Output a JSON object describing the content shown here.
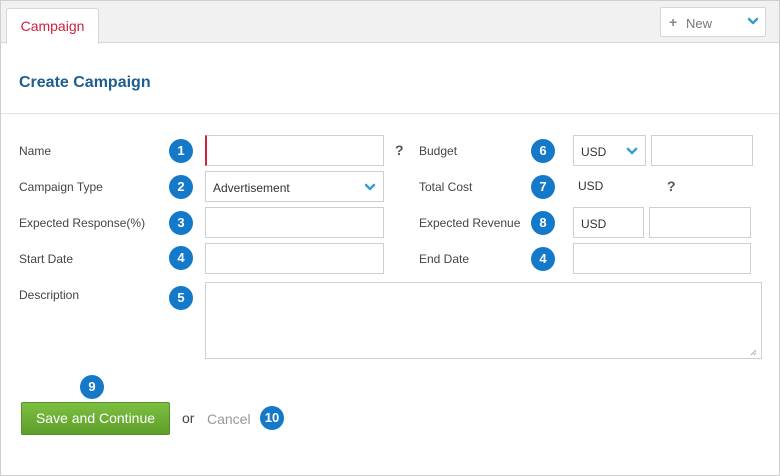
{
  "header": {
    "tab_label": "Campaign",
    "new_label": "New"
  },
  "page_title": "Create Campaign",
  "form": {
    "name": {
      "label": "Name",
      "value": "",
      "help": "?"
    },
    "campaign_type": {
      "label": "Campaign Type",
      "value": "Advertisement"
    },
    "expected_response": {
      "label": "Expected Response(%)",
      "value": ""
    },
    "start_date": {
      "label": "Start Date",
      "value": ""
    },
    "description": {
      "label": "Description",
      "value": ""
    },
    "budget": {
      "label": "Budget",
      "currency": "USD",
      "value": ""
    },
    "total_cost": {
      "label": "Total Cost",
      "currency": "USD",
      "help": "?"
    },
    "expected_revenue": {
      "label": "Expected Revenue",
      "currency": "USD",
      "value": ""
    },
    "end_date": {
      "label": "End Date",
      "value": ""
    }
  },
  "callouts": {
    "name": "1",
    "campaign_type": "2",
    "expected_response": "3",
    "start_date": "4",
    "description": "5",
    "budget": "6",
    "total_cost": "7",
    "expected_revenue": "8",
    "end_date": "4",
    "save": "9",
    "cancel": "10"
  },
  "actions": {
    "save_label": "Save and Continue",
    "or_label": "or",
    "cancel_label": "Cancel"
  },
  "colors": {
    "accent_red": "#d0203f",
    "title_blue": "#1e5e8f",
    "badge_blue": "#1479c9",
    "save_green": "#6fb038",
    "chevron_teal": "#3aa0c9"
  },
  "icons": [
    "plus-icon",
    "chevron-down-icon",
    "help-icon",
    "resize-grip-icon"
  ]
}
